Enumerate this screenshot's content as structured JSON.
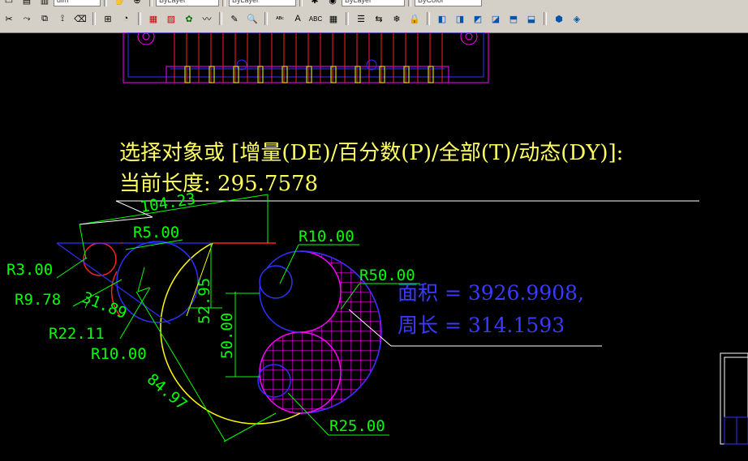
{
  "toolbar": {
    "row1": {
      "file_label": "dim",
      "layer_label": "ByLayer",
      "linetype_label": "ByLayer",
      "lineweight_label": "ByLayer",
      "plotstyle_label": "ByColor"
    },
    "row2_icons": [
      "trim-icon",
      "extend-icon",
      "copy-icon",
      "mirror-icon",
      "erase-icon",
      "dim-linear-icon",
      "dim-radius-icon",
      "hatch-icon",
      "region-icon",
      "block-icon",
      "polyline-icon",
      "match-prop-icon",
      "zoom-icon",
      "spell-icon",
      "text-style-icon",
      "mtext-icon",
      "table-icon",
      "layer-icon",
      "layer-prev-icon",
      "freeze-icon",
      "lock-icon",
      "view-front-icon",
      "view-top-icon",
      "view-left-icon",
      "view-right-icon",
      "view-iso-icon",
      "shade-icon"
    ]
  },
  "command": {
    "prompt_line": "选择对象或 [增量(DE)/百分数(P)/全部(T)/动态(DY)]:",
    "length_line": "当前长度: 295.7578"
  },
  "area_result": {
    "area_line": "面积 = 3926.9908,",
    "perimeter_line": "周长 = 314.1593"
  },
  "dimensions": {
    "d_104": "104.23",
    "r5": "R5.00",
    "r10_top": "R10.00",
    "r50": "R50.00",
    "r3": "R3.00",
    "r978": "R9.78",
    "d_3189": "31.89",
    "r2211": "R22.11",
    "r10_bottom": "R10.00",
    "d_5295": "52.95",
    "d_50": "50.00",
    "d_8497": "84.97",
    "r25": "R25.00"
  },
  "colors": {
    "background": "#000000",
    "dimension_green": "#00ff00",
    "hatch_magenta": "#ff00ff",
    "outline_blue": "#3030ff",
    "outline_red": "#ff2020",
    "outline_yellow": "#ffff00",
    "leader_white": "#ffffff",
    "command_yellow": "#ffff60",
    "result_blue": "#3a3aff"
  }
}
